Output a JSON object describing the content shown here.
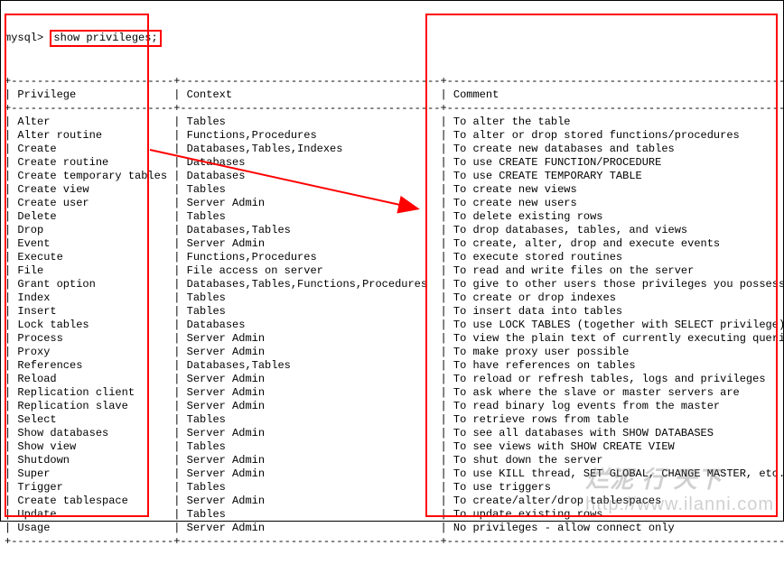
{
  "prompt": "mysql>",
  "command": "show privileges;",
  "headers": {
    "privilege": "Privilege",
    "context": "Context",
    "comment": "Comment"
  },
  "rows": [
    {
      "priv": "Alter",
      "ctx": "Tables",
      "cmt": "To alter the table"
    },
    {
      "priv": "Alter routine",
      "ctx": "Functions,Procedures",
      "cmt": "To alter or drop stored functions/procedures"
    },
    {
      "priv": "Create",
      "ctx": "Databases,Tables,Indexes",
      "cmt": "To create new databases and tables"
    },
    {
      "priv": "Create routine",
      "ctx": "Databases",
      "cmt": "To use CREATE FUNCTION/PROCEDURE"
    },
    {
      "priv": "Create temporary tables",
      "ctx": "Databases",
      "cmt": "To use CREATE TEMPORARY TABLE"
    },
    {
      "priv": "Create view",
      "ctx": "Tables",
      "cmt": "To create new views"
    },
    {
      "priv": "Create user",
      "ctx": "Server Admin",
      "cmt": "To create new users"
    },
    {
      "priv": "Delete",
      "ctx": "Tables",
      "cmt": "To delete existing rows"
    },
    {
      "priv": "Drop",
      "ctx": "Databases,Tables",
      "cmt": "To drop databases, tables, and views"
    },
    {
      "priv": "Event",
      "ctx": "Server Admin",
      "cmt": "To create, alter, drop and execute events"
    },
    {
      "priv": "Execute",
      "ctx": "Functions,Procedures",
      "cmt": "To execute stored routines"
    },
    {
      "priv": "File",
      "ctx": "File access on server",
      "cmt": "To read and write files on the server"
    },
    {
      "priv": "Grant option",
      "ctx": "Databases,Tables,Functions,Procedures",
      "cmt": "To give to other users those privileges you possess"
    },
    {
      "priv": "Index",
      "ctx": "Tables",
      "cmt": "To create or drop indexes"
    },
    {
      "priv": "Insert",
      "ctx": "Tables",
      "cmt": "To insert data into tables"
    },
    {
      "priv": "Lock tables",
      "ctx": "Databases",
      "cmt": "To use LOCK TABLES (together with SELECT privilege)"
    },
    {
      "priv": "Process",
      "ctx": "Server Admin",
      "cmt": "To view the plain text of currently executing queries"
    },
    {
      "priv": "Proxy",
      "ctx": "Server Admin",
      "cmt": "To make proxy user possible"
    },
    {
      "priv": "References",
      "ctx": "Databases,Tables",
      "cmt": "To have references on tables"
    },
    {
      "priv": "Reload",
      "ctx": "Server Admin",
      "cmt": "To reload or refresh tables, logs and privileges"
    },
    {
      "priv": "Replication client",
      "ctx": "Server Admin",
      "cmt": "To ask where the slave or master servers are"
    },
    {
      "priv": "Replication slave",
      "ctx": "Server Admin",
      "cmt": "To read binary log events from the master"
    },
    {
      "priv": "Select",
      "ctx": "Tables",
      "cmt": "To retrieve rows from table"
    },
    {
      "priv": "Show databases",
      "ctx": "Server Admin",
      "cmt": "To see all databases with SHOW DATABASES"
    },
    {
      "priv": "Show view",
      "ctx": "Tables",
      "cmt": "To see views with SHOW CREATE VIEW"
    },
    {
      "priv": "Shutdown",
      "ctx": "Server Admin",
      "cmt": "To shut down the server"
    },
    {
      "priv": "Super",
      "ctx": "Server Admin",
      "cmt": "To use KILL thread, SET GLOBAL, CHANGE MASTER, etc."
    },
    {
      "priv": "Trigger",
      "ctx": "Tables",
      "cmt": "To use triggers"
    },
    {
      "priv": "Create tablespace",
      "ctx": "Server Admin",
      "cmt": "To create/alter/drop tablespaces"
    },
    {
      "priv": "Update",
      "ctx": "Tables",
      "cmt": "To update existing rows"
    },
    {
      "priv": "Usage",
      "ctx": "Server Admin",
      "cmt": "No privileges - allow connect only"
    }
  ],
  "watermark": {
    "cn": "烂泥 行 天下",
    "url": "http://www.ilanni.com"
  },
  "colwidths": {
    "priv": 25,
    "ctx": 40
  }
}
